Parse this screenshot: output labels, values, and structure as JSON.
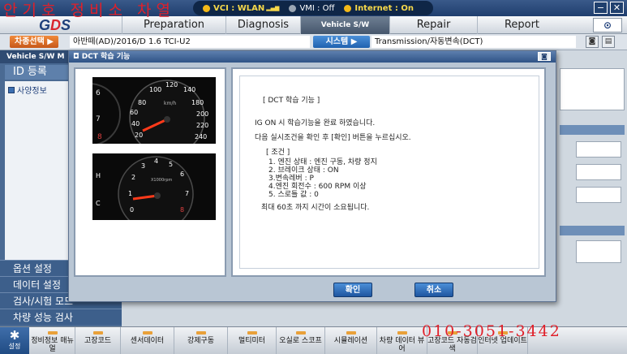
{
  "watermark": "안기호 정비소 차열",
  "status": {
    "vci": "VCI : WLAN",
    "vmi": "VMI : Off",
    "internet": "Internet : On"
  },
  "window_buttons": {
    "minimize": "−",
    "close": "✕"
  },
  "menu": {
    "logo": "GDS",
    "items": [
      {
        "label": "Preparation"
      },
      {
        "label": "Diagnosis"
      },
      {
        "label": "Vehicle S/W Management"
      },
      {
        "label": "Repair"
      },
      {
        "label": "Report"
      }
    ],
    "search_icon": "search-icon"
  },
  "vehicle_bar": {
    "select_label": "차종선택 ▶",
    "vehicle": "아반떼(AD)/2016/D 1.6 TCI-U2",
    "system_label": "시스템 ▶",
    "system": "Transmission/자동변속(DCT)"
  },
  "sidebar": {
    "title": "Vehicle S/W M",
    "id_label": "ID 등록",
    "info_label": "사양정보",
    "menu_items": [
      "옵션 설정",
      "데이터 설정",
      "검사/시험 모드",
      "차량 성능 검사"
    ]
  },
  "dialog": {
    "title": "DCT 학습 기능",
    "heading": "[ DCT 학습 기능 ]",
    "line1": "IG ON 시 학습기능을 완료 하였습니다.",
    "line2": "다음 실시조건을 확인 후 [확인] 버튼을 누르십시오.",
    "cond_title": "[ 조건 ]",
    "conditions": [
      "1. 엔진 상태 : 엔진 구동, 차량 정지",
      "2. 브레이크 상태 : ON",
      "3.변속레버 : P",
      "4.엔진 회전수 : 600 RPM 이상",
      "5. 스로틀 값 : 0"
    ],
    "line3": "최대 60초 까지 시간이 소요됩니다.",
    "ok_label": "확인",
    "cancel_label": "취소",
    "speedo_unit": "km/h",
    "tacho_unit": "X1000rpm"
  },
  "toolbar": {
    "setting": "설정",
    "items": [
      "정비정보 매뉴얼",
      "고장코드",
      "센서데이터",
      "강제구동",
      "멀티미터",
      "오실로 스코프",
      "시뮬레이션",
      "차량 데이터 뷰어",
      "고장코드 자동검색",
      "인터넷 업데이트"
    ]
  },
  "phone_overlay": "010-3051-3442"
}
